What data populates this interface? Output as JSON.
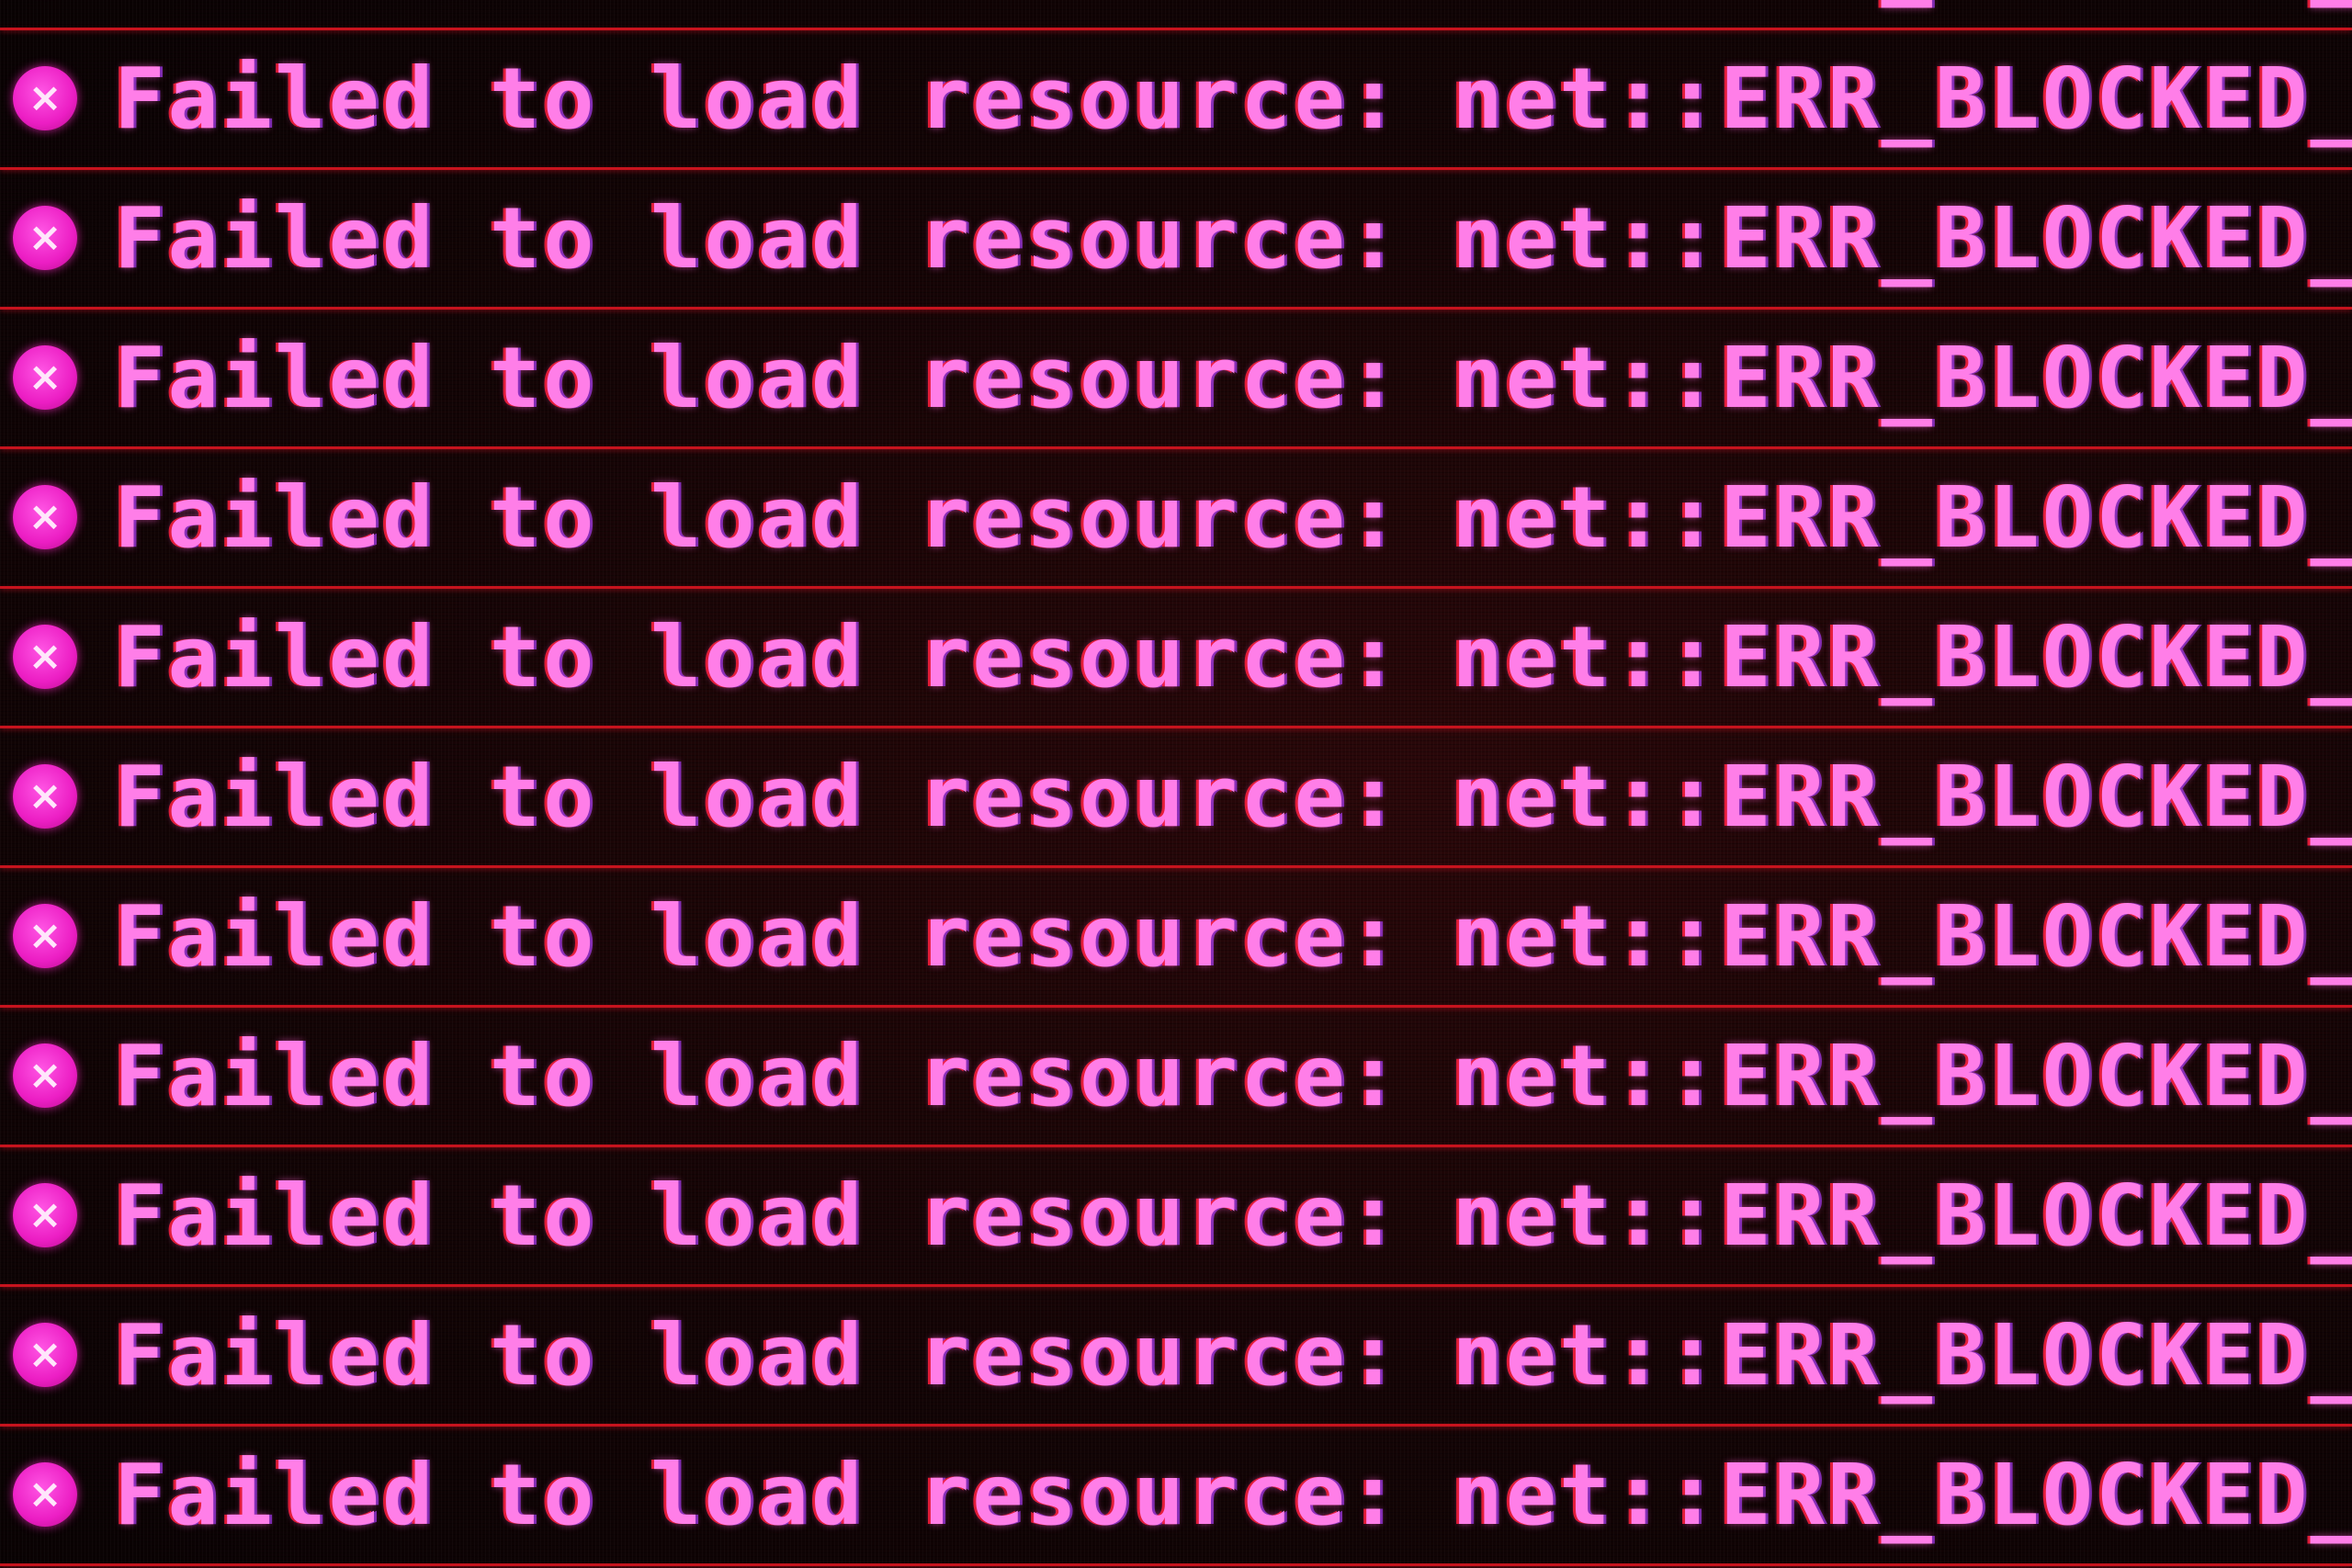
{
  "console": {
    "messages": [
      {
        "text_a": "Failed to load resource:",
        "text_b": "net::ERR_BLOCKED_BY_ADBLOCKER"
      },
      {
        "text_a": "Failed to load resource:",
        "text_b": "net::ERR_BLOCKED_BY_ADBLOCKER"
      },
      {
        "text_a": "Failed to load resource:",
        "text_b": "net::ERR_BLOCKED_BY_ADBLOCKER"
      },
      {
        "text_a": "Failed to load resource:",
        "text_b": "net::ERR_BLOCKED_BY_ADBLOCKER"
      },
      {
        "text_a": "Failed to load resource:",
        "text_b": "net::ERR_BLOCKED_BY_ADBLOCKER"
      },
      {
        "text_a": "Failed to load resource:",
        "text_b": "net::ERR_BLOCKED_BY_ADBLOCKER"
      },
      {
        "text_a": "Failed to load resource:",
        "text_b": "net::ERR_BLOCKED_BY_ADBLOCKER"
      },
      {
        "text_a": "Failed to load resource:",
        "text_b": "net::ERR_BLOCKED_BY_ADBLOCKER"
      },
      {
        "text_a": "Failed to load resource:",
        "text_b": "net::ERR_BLOCKED_BY_ADBLOCKER"
      },
      {
        "text_a": "Failed to load resource:",
        "text_b": "net::ERR_BLOCKED_BY_ADBLOCKER"
      },
      {
        "text_a": "Failed to load resource:",
        "text_b": "net::ERR_BLOCKED_BY_ADBLOCKER"
      },
      {
        "text_a": "Failed to load resource:",
        "text_b": "net::ERR_BLOCKED_BY_ADBLOCKER"
      }
    ],
    "error_icon_glyph": "×",
    "icon": "error-circle-x-icon",
    "colors": {
      "text": "#ff7ee8",
      "icon": "#ec1ec4",
      "divider": "#c4141d",
      "background": "#140405"
    }
  }
}
